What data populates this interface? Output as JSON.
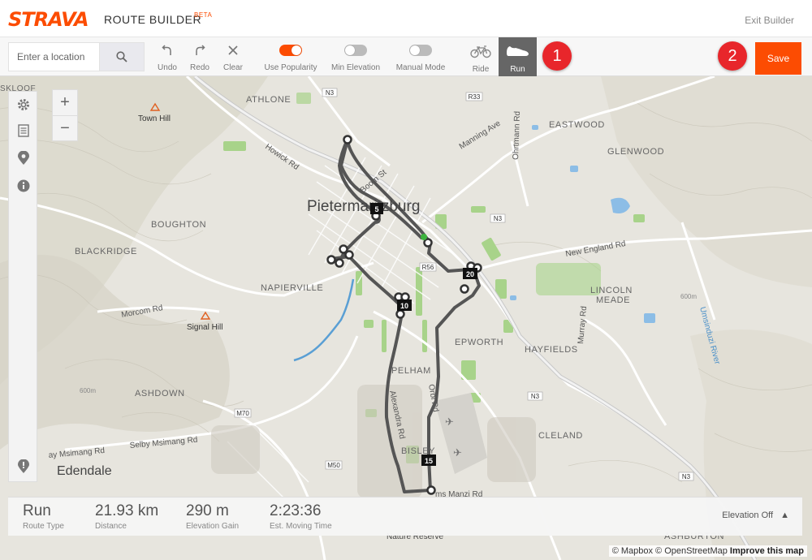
{
  "brand": {
    "logo": "STRAVA",
    "title": "ROUTE BUILDER",
    "beta": "BETA",
    "exit": "Exit Builder"
  },
  "search": {
    "placeholder": "Enter a location"
  },
  "toolbar": {
    "undo": "Undo",
    "redo": "Redo",
    "clear": "Clear",
    "use_popularity": "Use Popularity",
    "min_elevation": "Min Elevation",
    "manual_mode": "Manual Mode",
    "ride": "Ride",
    "run": "Run",
    "save": "Save",
    "toggles": {
      "use_popularity": true,
      "min_elevation": false,
      "manual_mode": false
    }
  },
  "badges": {
    "one": "1",
    "two": "2"
  },
  "map": {
    "places": {
      "pietermaritzburg": "Pietermaritzburg",
      "athlone": "ATHLONE",
      "boughton": "BOUGHTON",
      "blackridge": "BLACKRIDGE",
      "napierville": "NAPIERVILLE",
      "ashdown": "ASHDOWN",
      "edendale": "Edendale",
      "eastwood": "EASTWOOD",
      "glenwood": "GLENWOOD",
      "lincoln_meade_1": "LINCOLN",
      "lincoln_meade_2": "MEADE",
      "hayfields": "HAYFIELDS",
      "epworth": "EPWORTH",
      "pelham": "PELHAM",
      "bisley": "BISLEY",
      "cleland": "CLELAND",
      "ashburton": "ASHBURTON",
      "nature_reserve": "Nature Reserve",
      "town_hill": "Town Hill",
      "signal_hill": "Signal Hill"
    },
    "roads": {
      "n3_a": "N3",
      "n3_b": "N3",
      "n3_c": "N3",
      "n3_d": "N3",
      "r33": "R33",
      "r56": "R56",
      "m70": "M70",
      "m50": "M50",
      "manning_ave": "Manning Ave",
      "howick_rd": "Howick Rd",
      "boom_st": "Boom St",
      "new_england_rd": "New England Rd",
      "morcom_rd": "Morcom Rd",
      "selby_msimang_rd": "Selby Msimang Rd",
      "selby_msimang_rd_2": "ay Msimang Rd",
      "murray_rd": "Murray Rd",
      "alexandra_rd": "Alexandra Rd",
      "ohrtmann_rd": "Ohrtmann Rd",
      "umsinduzi_river": "Umsinduzi River",
      "orbi_rd": "Orbi Rd",
      "ms_manzi": "ms Manzi Rd",
      "contour_600_a": "600m",
      "contour_600_b": "600m",
      "skloof": "SKLOOF"
    },
    "markers": {
      "m5": "5",
      "m10": "10",
      "m15": "15",
      "m20": "20"
    }
  },
  "stats": {
    "route_type": {
      "value": "Run",
      "label": "Route Type"
    },
    "distance": {
      "value": "21.93 km",
      "label": "Distance"
    },
    "elevation_gain": {
      "value": "290 m",
      "label": "Elevation Gain"
    },
    "moving_time": {
      "value": "2:23:36",
      "label": "Est. Moving Time"
    },
    "elevation_toggle": "Elevation Off"
  },
  "attribution": {
    "text": "© Mapbox © OpenStreetMap",
    "improve": "Improve this map"
  },
  "colors": {
    "accent": "#fc4c02",
    "badge": "#e8262b",
    "route": "#555555",
    "map_bg": "#e6e4dd",
    "river": "#5a9fd4",
    "park": "#9ccf7a"
  }
}
